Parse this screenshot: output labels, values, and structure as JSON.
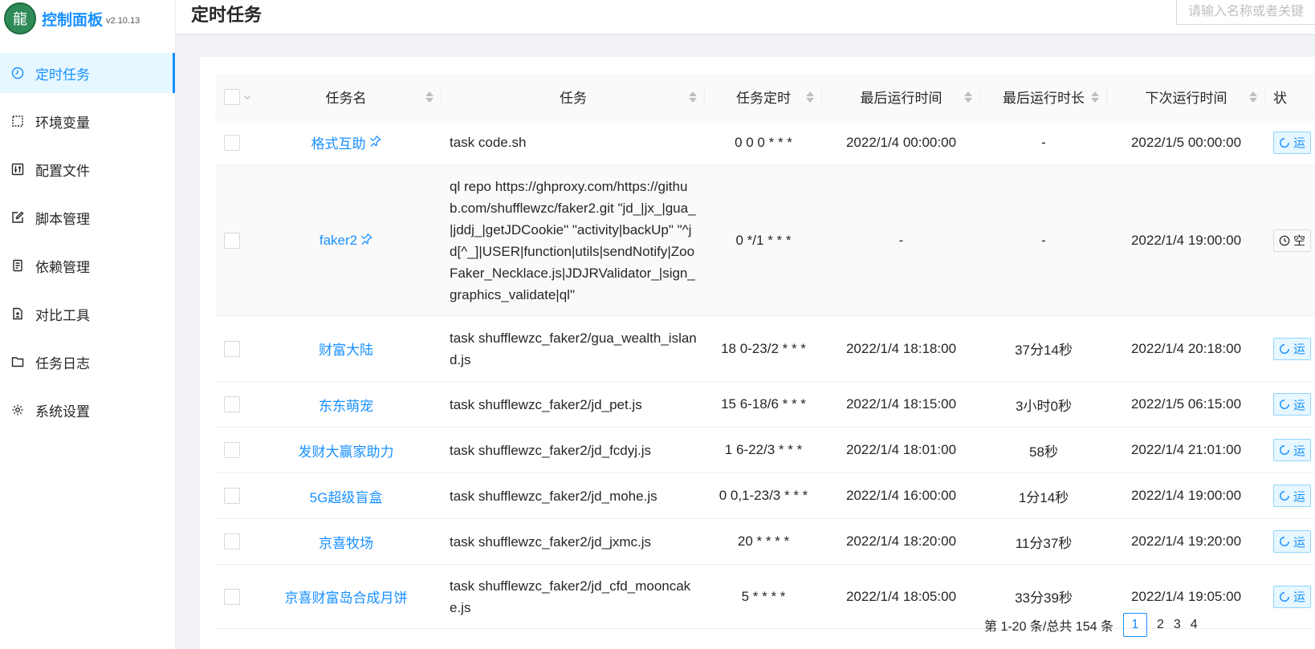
{
  "app": {
    "logo_title": "控制面板",
    "version": "v2.10.13"
  },
  "sidebar": {
    "items": [
      {
        "label": "定时任务",
        "icon": "clock-icon",
        "active": true
      },
      {
        "label": "环境变量",
        "icon": "variable-icon"
      },
      {
        "label": "配置文件",
        "icon": "sliders-icon"
      },
      {
        "label": "脚本管理",
        "icon": "edit-icon"
      },
      {
        "label": "依赖管理",
        "icon": "book-icon"
      },
      {
        "label": "对比工具",
        "icon": "diff-icon"
      },
      {
        "label": "任务日志",
        "icon": "folder-icon"
      },
      {
        "label": "系统设置",
        "icon": "gear-icon"
      }
    ]
  },
  "header": {
    "title": "定时任务",
    "search_placeholder": "请输入名称或者关键"
  },
  "table": {
    "columns": [
      "任务名",
      "任务",
      "任务定时",
      "最后运行时间",
      "最后运行时长",
      "下次运行时间",
      "状"
    ],
    "rows": [
      {
        "name": "格式互助",
        "pinned": true,
        "task": "task code.sh",
        "cron": "0 0 0 * * *",
        "last_run": "2022/1/4 00:00:00",
        "duration": "-",
        "next_run": "2022/1/5 00:00:00",
        "status": "running",
        "status_text": "运"
      },
      {
        "name": "faker2",
        "pinned": true,
        "task": "ql repo https://ghproxy.com/https://github.com/shufflewzc/faker2.git \"jd_|jx_|gua_|jddj_|getJDCookie\" \"activity|backUp\" \"^jd[^_]|USER|function|utils|sendNotify|ZooFaker_Necklace.js|JDJRValidator_|sign_graphics_validate|ql\"",
        "cron": "0 */1 * * *",
        "last_run": "-",
        "duration": "-",
        "next_run": "2022/1/4 19:00:00",
        "status": "idle",
        "status_text": "空"
      },
      {
        "name": "财富大陆",
        "pinned": false,
        "task": "task shufflewzc_faker2/gua_wealth_island.js",
        "cron": "18 0-23/2 * * *",
        "last_run": "2022/1/4 18:18:00",
        "duration": "37分14秒",
        "next_run": "2022/1/4 20:18:00",
        "status": "running",
        "status_text": "运"
      },
      {
        "name": "东东萌宠",
        "pinned": false,
        "task": "task shufflewzc_faker2/jd_pet.js",
        "cron": "15 6-18/6 * * *",
        "last_run": "2022/1/4 18:15:00",
        "duration": "3小时0秒",
        "next_run": "2022/1/5 06:15:00",
        "status": "running",
        "status_text": "运"
      },
      {
        "name": "发财大赢家助力",
        "pinned": false,
        "task": "task shufflewzc_faker2/jd_fcdyj.js",
        "cron": "1 6-22/3 * * *",
        "last_run": "2022/1/4 18:01:00",
        "duration": "58秒",
        "next_run": "2022/1/4 21:01:00",
        "status": "running",
        "status_text": "运"
      },
      {
        "name": "5G超级盲盒",
        "pinned": false,
        "task": "task shufflewzc_faker2/jd_mohe.js",
        "cron": "0 0,1-23/3 * * *",
        "last_run": "2022/1/4 16:00:00",
        "duration": "1分14秒",
        "next_run": "2022/1/4 19:00:00",
        "status": "running",
        "status_text": "运"
      },
      {
        "name": "京喜牧场",
        "pinned": false,
        "task": "task shufflewzc_faker2/jd_jxmc.js",
        "cron": "20 * * * *",
        "last_run": "2022/1/4 18:20:00",
        "duration": "11分37秒",
        "next_run": "2022/1/4 19:20:00",
        "status": "running",
        "status_text": "运"
      },
      {
        "name": "京喜财富岛合成月饼",
        "pinned": false,
        "task": "task shufflewzc_faker2/jd_cfd_mooncake.js",
        "cron": "5 * * * *",
        "last_run": "2022/1/4 18:05:00",
        "duration": "33分39秒",
        "next_run": "2022/1/4 19:05:00",
        "status": "running",
        "status_text": "运"
      }
    ]
  },
  "pagination": {
    "summary": "第 1-20 条/总共 154 条",
    "current": "1",
    "pages": [
      "2",
      "3",
      "4"
    ]
  }
}
